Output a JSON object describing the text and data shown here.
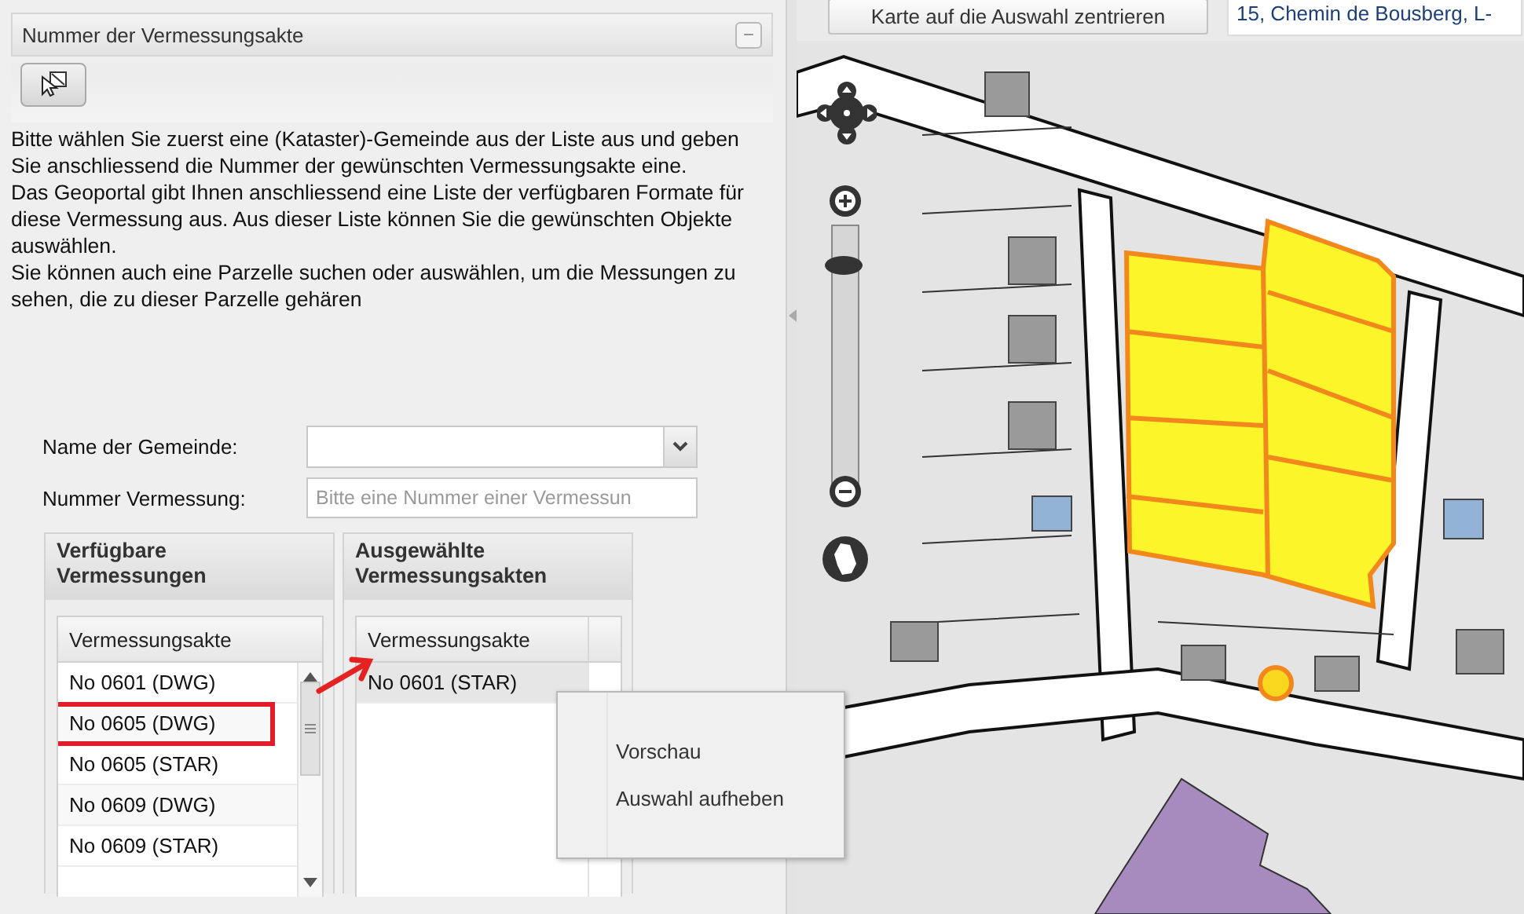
{
  "panel": {
    "title": "Nummer der Vermessungsakte",
    "collapse_button": "−",
    "description": [
      "Bitte wählen Sie zuerst eine (Kataster)-Gemeinde aus der Liste aus und geben Sie anschliessend die Nummer der gewünschten Vermessungsakte eine.",
      "Das Geoportal gibt Ihnen anschliessend eine Liste der verfügbaren Formate für diese Vermessung aus. Aus dieser Liste können Sie die gewünschten Objekte auswählen.",
      "Sie können auch eine Parzelle suchen oder auswählen, um die Messungen zu sehen, die zu dieser Parzelle gehären"
    ]
  },
  "form": {
    "fields": [
      {
        "kind": "combo",
        "label": "Name der Gemeinde:"
      },
      {
        "kind": "text",
        "label": "Nummer Vermessung:",
        "placeholder": "Bitte eine Nummer einer Vermessun"
      }
    ]
  },
  "available": {
    "title": "Verfügbare Vermessungen",
    "column": "Vermessungsakte",
    "rows": [
      {
        "text": "No 0601 (DWG)",
        "selected": false,
        "marked": false
      },
      {
        "text": "No 0605 (DWG)",
        "selected": false,
        "marked": true
      },
      {
        "text": "No 0605 (STAR)",
        "selected": false,
        "marked": false
      },
      {
        "text": "No 0609 (DWG)",
        "selected": false,
        "marked": false
      },
      {
        "text": "No 0609 (STAR)",
        "selected": false,
        "marked": false
      }
    ]
  },
  "chosen": {
    "title": "Ausgewählte Vermessungsakten",
    "column": "Vermessungsakte",
    "rows": [
      {
        "text": "No 0601 (STAR)",
        "selected": true
      }
    ]
  },
  "context_menu": {
    "items": [
      "Vorschau",
      "Auswahl aufheben"
    ]
  },
  "map_toolbar": {
    "center_button": "Karte auf die Auswahl zentrieren",
    "address": "15, Chemin de Bousberg, L-"
  },
  "zoom": {
    "level": 0.88
  }
}
